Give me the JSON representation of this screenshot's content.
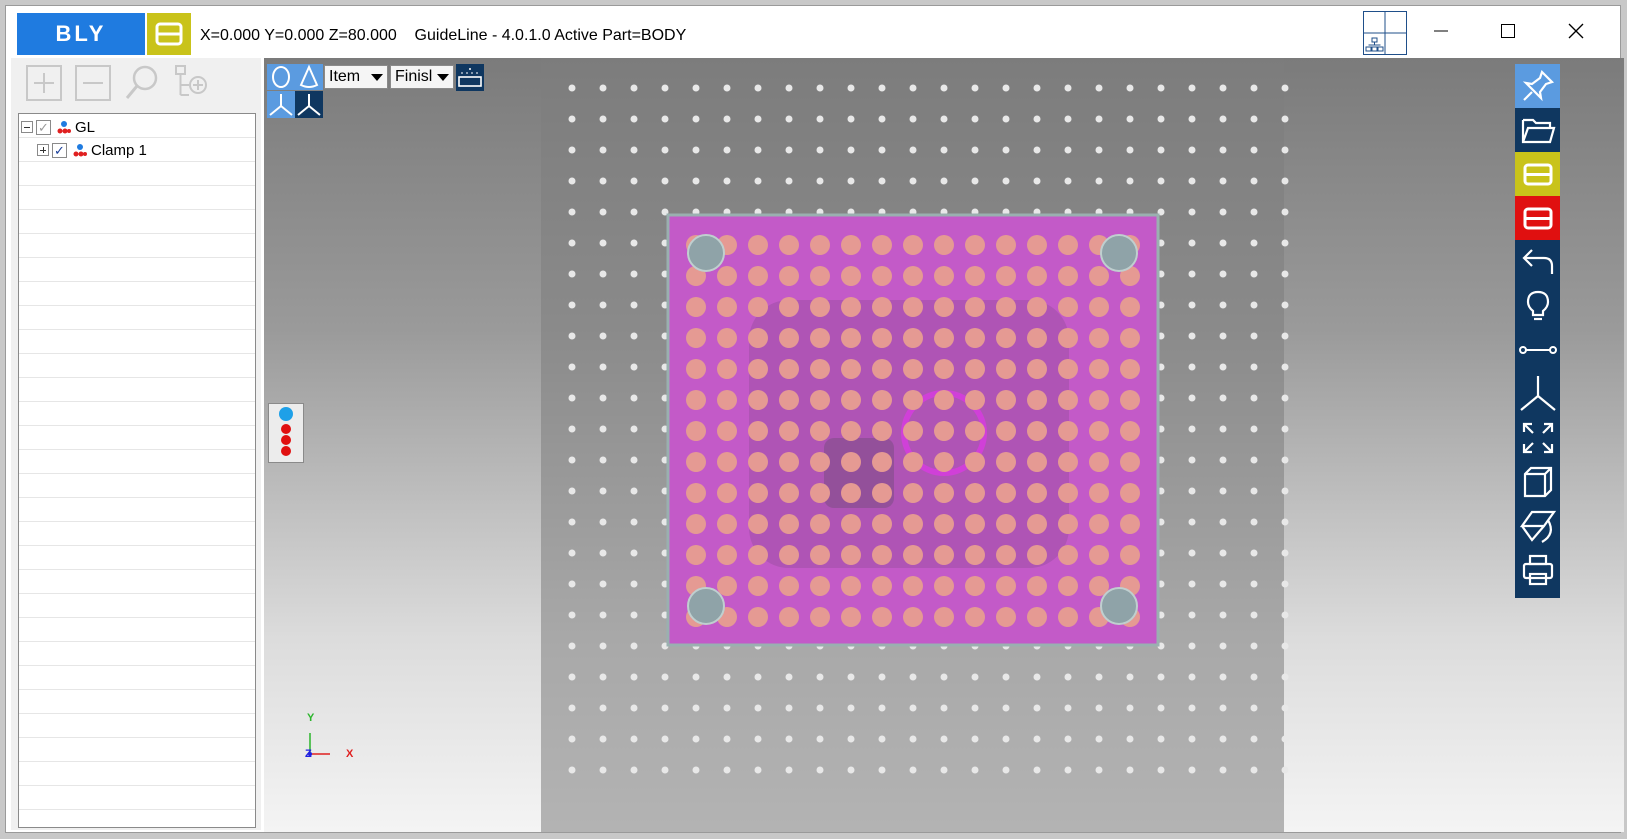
{
  "titlebar": {
    "logo_text": "BLY",
    "coords_text": "X=0.000 Y=0.000 Z=80.000    GuideLine - 4.0.1.0 Active Part=BODY",
    "brand_blue": "#1f7be0",
    "brand_yellow": "#c9c31a",
    "brand_red": "#e01010"
  },
  "tree": {
    "items": [
      {
        "label": "GL",
        "checked": true
      },
      {
        "label": "Clamp 1",
        "checked": true
      }
    ]
  },
  "viewport_toolbar": {
    "mode_select": "Item",
    "finish_select": "Finisl"
  },
  "axes": {
    "y": "Y",
    "x": "X",
    "z": "Z"
  },
  "icons": {
    "left_tools": [
      "add-icon",
      "remove-icon",
      "search-icon",
      "tree-add-icon"
    ],
    "right_tools": [
      "pin-icon",
      "folder-open-icon",
      "b-yellow-icon",
      "b-red-icon",
      "undo-icon",
      "lightbulb-icon",
      "measure-icon",
      "axis-icon",
      "fit-extent-icon",
      "box-view-icon",
      "rotate-view-icon",
      "print-icon"
    ]
  },
  "scene": {
    "plate_color": "#c35ac8",
    "ball_color": "#e59a93",
    "hole_color": "#8fa3a8"
  }
}
